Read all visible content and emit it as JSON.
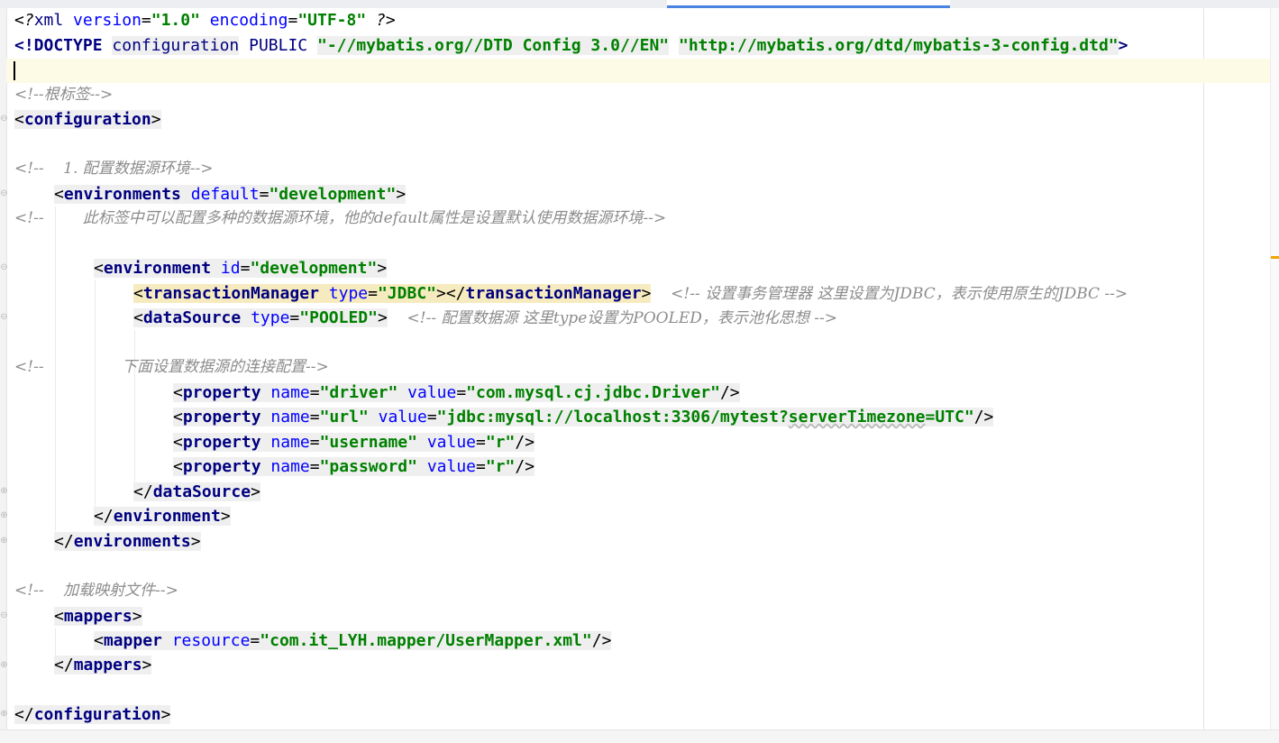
{
  "colors": {
    "editor_background": "#ffffff",
    "tag_color": "#000080",
    "attribute_color": "#0000ff",
    "value_color": "#008000",
    "comment_color": "#8c8c8c",
    "current_line": "#fdfbe6",
    "matched_tag_highlight": "#f6ebbf",
    "tab_accent": "#4a83e0"
  },
  "code": {
    "xml_decl": {
      "open": "<?",
      "name": "xml",
      "attr1": "version",
      "val1": "\"1.0\"",
      "attr2": "encoding",
      "val2": "\"UTF-8\"",
      "close": "?>"
    },
    "doctype": {
      "keyword": "<!DOCTYPE",
      "root": "configuration",
      "public": "PUBLIC",
      "id": "\"-//mybatis.org//DTD Config 3.0//EN\"",
      "url": "\"http://mybatis.org/dtd/mybatis-3-config.dtd\"",
      "close": ">"
    },
    "comment_root": "<!--根标签-->",
    "tag_configuration": "configuration",
    "comment_env": "<!--    1. 配置数据源环境-->",
    "environments_tag": "environments",
    "environments_attr": "default",
    "environments_val": "\"development\"",
    "comment_env_desc": "<!--        此标签中可以配置多种的数据源环境，他的default属性是设置默认使用数据源环境-->",
    "environment_tag": "environment",
    "environment_attr": "id",
    "environment_val": "\"development\"",
    "transaction_tag": "transactionManager",
    "transaction_attr": "type",
    "transaction_val": "\"JDBC\"",
    "transaction_comment": "<!-- 设置事务管理器 这里设置为JDBC，表示使用原生的JDBC -->",
    "datasource_tag": "dataSource",
    "datasource_attr": "type",
    "datasource_val": "\"POOLED\"",
    "datasource_comment": "<!-- 配置数据源 这里type设置为POOLED，表示池化思想 -->",
    "comment_conn": "<!--                下面设置数据源的连接配置-->",
    "property_tag": "property",
    "name_attr": "name",
    "value_attr": "value",
    "properties": [
      {
        "name": "\"driver\"",
        "value": "\"com.mysql.cj.jdbc.Driver\""
      },
      {
        "name": "\"url\"",
        "value_pre": "\"jdbc:mysql://localhost:3306/mytest?",
        "value_sq": "serverTimezone",
        "value_post": "=UTC\""
      },
      {
        "name": "\"username\"",
        "value": "\"r\""
      },
      {
        "name": "\"password\"",
        "value": "\"r\""
      }
    ],
    "comment_mapper": "<!--    加载映射文件-->",
    "mappers_tag": "mappers",
    "mapper_tag": "mapper",
    "mapper_attr": "resource",
    "mapper_val": "\"com.it_LYH.mapper/UserMapper.xml\""
  }
}
